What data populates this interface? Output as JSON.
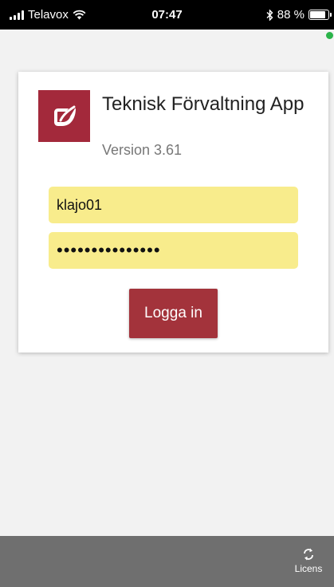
{
  "status_bar": {
    "carrier": "Telavox",
    "time": "07:47",
    "battery_label": "88 %",
    "battery_level": 0.88
  },
  "connection_indicator": {
    "color": "#2bb34a"
  },
  "login_card": {
    "title": "Teknisk Förvaltning App",
    "version": "Version 3.61",
    "username_value": "klajo01",
    "password_mask": "•••••••••••••••",
    "login_button": "Logga in",
    "logo_icon": "leaf-icon",
    "accent_color": "#a3293b",
    "field_color": "#f8ec8c"
  },
  "footer": {
    "licens_label": "Licens",
    "licens_icon": "refresh-icon"
  }
}
